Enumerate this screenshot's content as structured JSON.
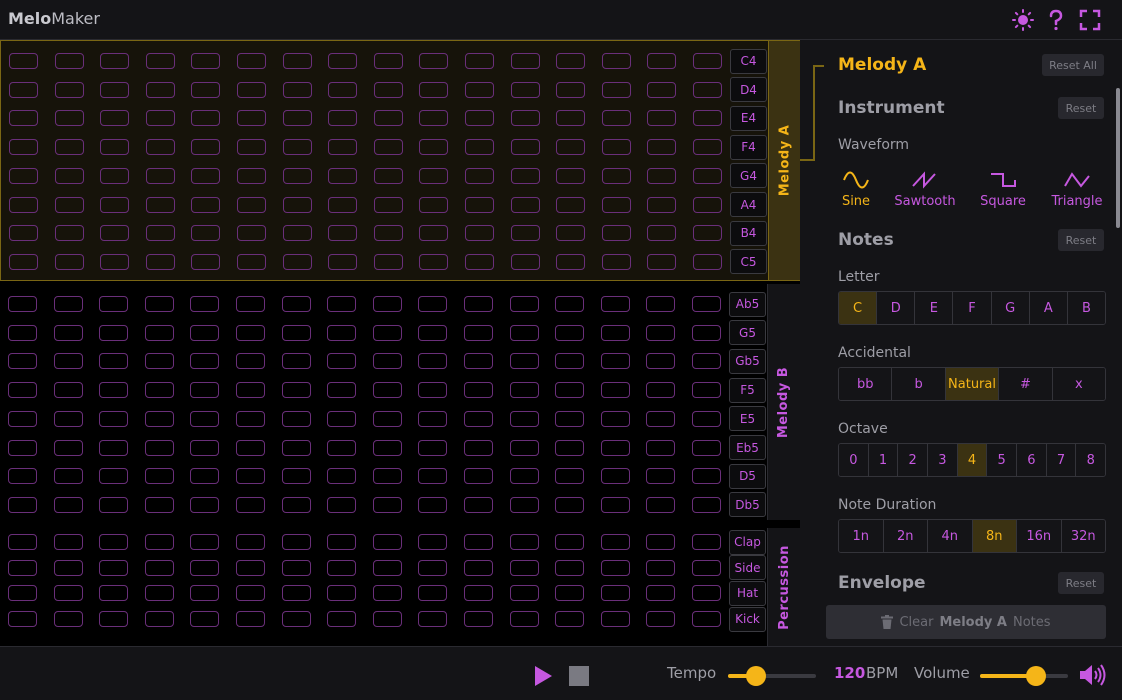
{
  "app": {
    "brand_bold": "Melo",
    "brand_rest": "Maker"
  },
  "header": {
    "icons": [
      "sun-icon",
      "help-icon",
      "fullscreen-icon"
    ]
  },
  "colors": {
    "accent_purple": "#c658e0",
    "accent_gold": "#f5b518",
    "cell_border": "#6a2f7a"
  },
  "grid": {
    "columns": 16,
    "sections": [
      {
        "id": "melody-a",
        "title": "Melody A",
        "active": true,
        "notes": [
          "C4",
          "D4",
          "E4",
          "F4",
          "G4",
          "A4",
          "B4",
          "C5"
        ]
      },
      {
        "id": "melody-b",
        "title": "Melody B",
        "active": false,
        "notes": [
          "Ab5",
          "G5",
          "Gb5",
          "F5",
          "E5",
          "Eb5",
          "D5",
          "Db5"
        ]
      },
      {
        "id": "percussion",
        "title": "Percussion",
        "active": false,
        "notes": [
          "Clap",
          "Side",
          "Hat",
          "Kick"
        ]
      }
    ]
  },
  "sidebar": {
    "title": "Melody A",
    "reset_all": "Reset All",
    "instrument": {
      "heading": "Instrument",
      "reset": "Reset",
      "waveform_label": "Waveform",
      "waveforms": [
        {
          "label": "Sine",
          "icon": "sine-wave-icon",
          "selected": true
        },
        {
          "label": "Sawtooth",
          "icon": "sawtooth-wave-icon",
          "selected": false
        },
        {
          "label": "Square",
          "icon": "square-wave-icon",
          "selected": false
        },
        {
          "label": "Triangle",
          "icon": "triangle-wave-icon",
          "selected": false
        }
      ]
    },
    "notes": {
      "heading": "Notes",
      "reset": "Reset",
      "letter_label": "Letter",
      "letters": [
        "C",
        "D",
        "E",
        "F",
        "G",
        "A",
        "B"
      ],
      "letter_selected": "C",
      "accidental_label": "Accidental",
      "accidentals": [
        "bb",
        "b",
        "Natural",
        "#",
        "x"
      ],
      "accidental_selected": "Natural",
      "octave_label": "Octave",
      "octaves": [
        "0",
        "1",
        "2",
        "3",
        "4",
        "5",
        "6",
        "7",
        "8"
      ],
      "octave_selected": "4",
      "duration_label": "Note Duration",
      "durations": [
        "1n",
        "2n",
        "4n",
        "8n",
        "16n",
        "32n"
      ],
      "duration_selected": "8n"
    },
    "envelope": {
      "heading": "Envelope",
      "reset": "Reset"
    },
    "clear": {
      "prefix": "Clear",
      "target": "Melody A",
      "suffix": "Notes"
    }
  },
  "footer": {
    "tempo_label": "Tempo",
    "tempo_value": "120",
    "tempo_unit": "BPM",
    "tempo_fraction": 0.32,
    "volume_label": "Volume",
    "volume_fraction": 0.64
  }
}
